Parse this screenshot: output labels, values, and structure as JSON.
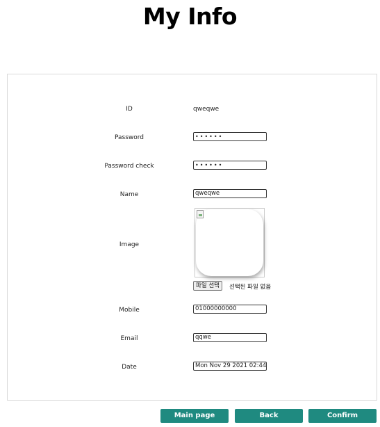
{
  "page": {
    "title": "My Info"
  },
  "form": {
    "id": {
      "label": "ID",
      "value": "qweqwe"
    },
    "password": {
      "label": "Password",
      "value": "••••••"
    },
    "password_check": {
      "label": "Password check",
      "value": "••••••"
    },
    "name": {
      "label": "Name",
      "value": "qweqwe"
    },
    "image": {
      "label": "Image",
      "file_button": "파일 선택",
      "file_status": "선택된 파일 없음"
    },
    "mobile": {
      "label": "Mobile",
      "value": "01000000000"
    },
    "email": {
      "label": "Email",
      "value": "qqwe"
    },
    "date": {
      "label": "Date",
      "value": "Mon Nov 29 2021 02:44:"
    }
  },
  "actions": {
    "main_page": "Main page",
    "back": "Back",
    "confirm": "Confirm"
  },
  "colors": {
    "button_bg": "#1f8a80",
    "button_text": "#ffffff"
  }
}
